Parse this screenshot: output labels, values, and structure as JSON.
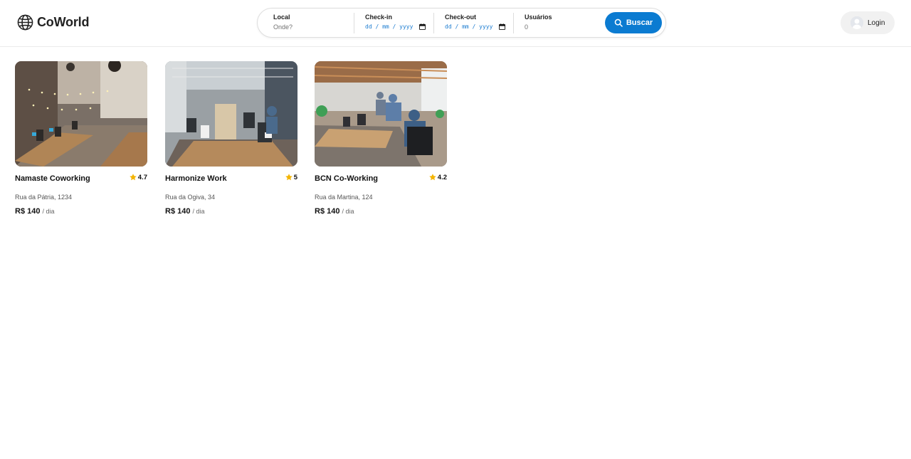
{
  "header": {
    "brand": "CoWorld",
    "search": {
      "local_label": "Local",
      "local_placeholder": "Onde?",
      "checkin_label": "Check-in",
      "checkin_value": "dd / mm / yyyy",
      "checkout_label": "Check-out",
      "checkout_value": "dd / mm / yyyy",
      "users_label": "Usuários",
      "users_value": "0",
      "button_label": "Buscar"
    },
    "login_label": "Login"
  },
  "listings": [
    {
      "name": "Namaste Coworking",
      "rating": "4.7",
      "address": "Rua da Pátria, 1234",
      "price": "R$ 140",
      "unit": "/ dia"
    },
    {
      "name": "Harmonize Work",
      "rating": "5",
      "address": "Rua da Ogiva, 34",
      "price": "R$ 140",
      "unit": "/ dia"
    },
    {
      "name": "BCN Co-Working",
      "rating": "4.2",
      "address": "Rua da Martina, 124",
      "price": "R$ 140",
      "unit": "/ dia"
    }
  ],
  "colors": {
    "accent": "#0b7bd1",
    "star": "#f4b400",
    "date_text": "#1a7bd0"
  },
  "icons": [
    "globe-icon",
    "calendar-icon",
    "search-icon",
    "user-avatar-icon",
    "star-icon"
  ]
}
